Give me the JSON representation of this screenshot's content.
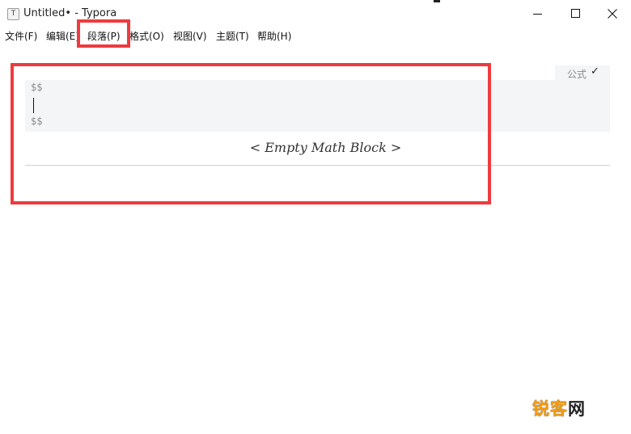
{
  "window": {
    "app_icon_glyph": "T",
    "title": "Untitled• - Typora"
  },
  "menu": {
    "items": [
      {
        "label": "文件(F)"
      },
      {
        "label": "编辑(E)"
      },
      {
        "label": "段落(P)"
      },
      {
        "label": "格式(O)"
      },
      {
        "label": "视图(V)"
      },
      {
        "label": "主题(T)"
      },
      {
        "label": "帮助(H)"
      }
    ]
  },
  "math_block": {
    "label": "公式",
    "check": "✓",
    "open_delim": "$$",
    "close_delim": "$$",
    "placeholder": "< Empty Math Block >"
  },
  "watermark": {
    "part1": "锐客",
    "part2": "网"
  },
  "colors": {
    "highlight": "#ee3b3f",
    "block_bg": "#f4f5f7",
    "watermark_orange": "#f39c12"
  }
}
